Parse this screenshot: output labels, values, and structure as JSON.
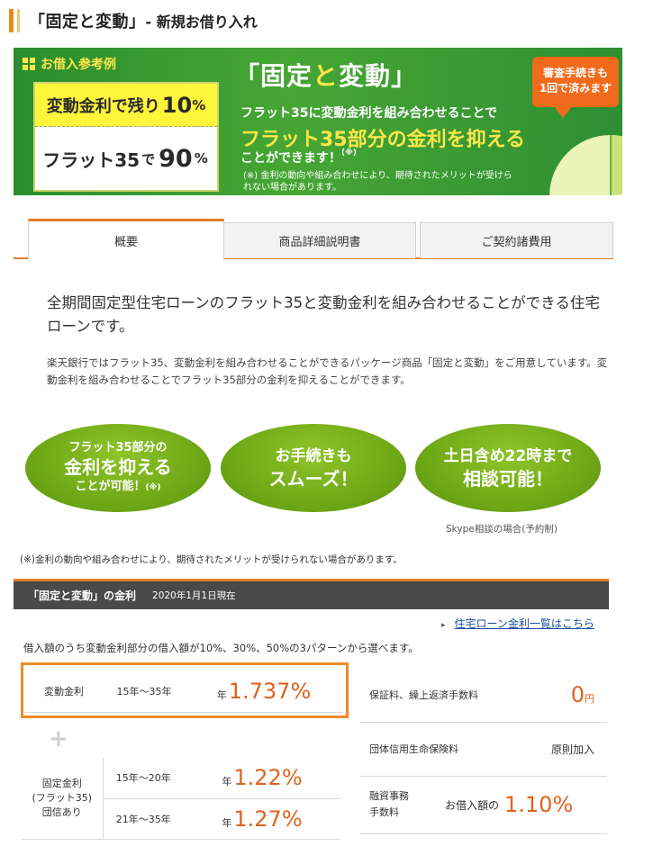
{
  "header": {
    "title": "「固定と変動」",
    "subtitle": "- 新規お借り入れ"
  },
  "banner": {
    "example_label": "お借入参考例",
    "variable_text": "変動金利で残り",
    "variable_pct": "10",
    "variable_unit": "%",
    "flat_text": "フラット35",
    "flat_de": "で",
    "flat_pct": "90",
    "flat_unit": "%",
    "brand_open": "「",
    "brand_a": "固定",
    "brand_to": "と",
    "brand_b": "変動",
    "brand_close": "」",
    "line1": "フラット35に変動金利を組み合わせることで",
    "line2": "フラット35部分の金利を抑える",
    "line3": "ことができます！",
    "line3_mark": "(※)",
    "note": "(※) 金利の動向や組み合わせにより、期待されたメリットが受けられない場合があります。",
    "callout_line1": "審査手続きも",
    "callout_line2": "1回で済みます",
    "colors": {
      "green": "#2a8d2e",
      "yellow": "#ffe64a",
      "orange": "#f26a1b"
    }
  },
  "tabs": [
    {
      "label": "概要",
      "active": true
    },
    {
      "label": "商品詳細説明書",
      "active": false
    },
    {
      "label": "ご契約諸費用",
      "active": false
    }
  ],
  "intro": {
    "lead": "全期間固定型住宅ローンのフラット35と変動金利を組み合わせることができる住宅ローンです。",
    "description": "楽天銀行ではフラット35、変動金利を組み合わせることができるパッケージ商品「固定と変動」をご用意しています。変動金利を組み合わせることでフラット35部分の金利を抑えることができます。"
  },
  "features": {
    "f1_line1": "フラット35部分の",
    "f1_line2": "金利を抑える",
    "f1_line3": "ことが可能！",
    "f1_mark": "(※)",
    "f2_line1": "お手続きも",
    "f2_line2": "スムーズ！",
    "f3_line1": "土日含め22時まで",
    "f3_line2": "相談可能！",
    "f3_note": "Skype相談の場合(予約制)"
  },
  "footnote": "(※)金利の動向や組み合わせにより、期待されたメリットが受けられない場合があります。",
  "rates": {
    "section_title": "「固定と変動」の金利",
    "as_of": "2020年1月1日現在",
    "link_text": "住宅ローン金利一覧はこちら",
    "intro": "借入額のうち変動金利部分の借入額が10%、30%、50%の3パターンから選べます。",
    "year_prefix": "年",
    "variable": {
      "label": "変動金利",
      "term": "15年～35年",
      "rate": "1.737%"
    },
    "plus": "+",
    "fixed": {
      "label_line1": "固定金利",
      "label_line2": "(フラット35)",
      "label_line3": "団信あり",
      "rows": [
        {
          "term": "15年～20年",
          "rate": "1.22%"
        },
        {
          "term": "21年～35年",
          "rate": "1.27%"
        }
      ]
    },
    "fees": [
      {
        "label": "保証料、繰上返済手数料",
        "value": "0",
        "unit": "円"
      },
      {
        "label": "団体信用生命保険料",
        "value": "原則加入"
      },
      {
        "label_line1": "融資事務",
        "label_line2": "手数料",
        "prefix": "お借入額の",
        "value": "1.10%"
      }
    ],
    "highlight_color": "#f08a2a",
    "accent_color": "#e0621e"
  }
}
